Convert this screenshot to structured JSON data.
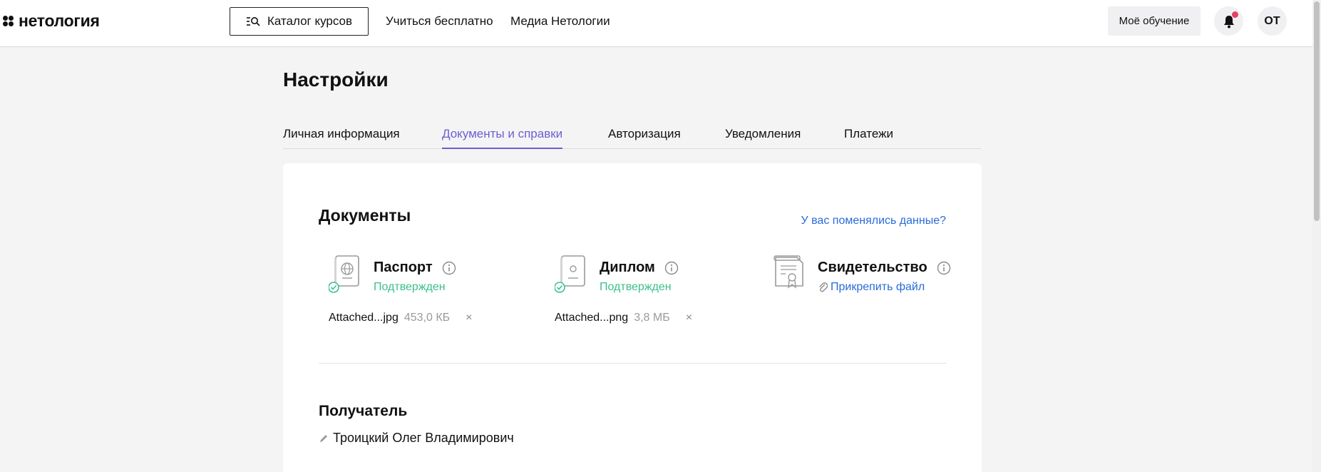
{
  "header": {
    "logo_text": "нетология",
    "catalog_label": "Каталог курсов",
    "nav": {
      "learn_free": "Учиться бесплатно",
      "media": "Медиа Нетологии"
    },
    "my_learning_label": "Моё обучение",
    "avatar_initials": "ОТ",
    "notification_dot_color": "#e63f66"
  },
  "page": {
    "title": "Настройки",
    "tabs": [
      {
        "label": "Личная информация",
        "active": false
      },
      {
        "label": "Документы и справки",
        "active": true
      },
      {
        "label": "Авторизация",
        "active": false
      },
      {
        "label": "Уведомления",
        "active": false
      },
      {
        "label": "Платежи",
        "active": false
      }
    ]
  },
  "documents": {
    "title": "Документы",
    "changed_link": "У вас поменялись данные?",
    "items": [
      {
        "name": "Паспорт",
        "icon": "passport-icon",
        "status": "Подтвержден",
        "file_name": "Attached...jpg",
        "file_size": "453,0 КБ",
        "remove": "×"
      },
      {
        "name": "Диплом",
        "icon": "diploma-icon",
        "status": "Подтвержден",
        "file_name": "Attached...png",
        "file_size": "3,8 МБ",
        "remove": "×"
      },
      {
        "name": "Свидетельство",
        "icon": "certificate-icon",
        "attach_label": "Прикрепить файл"
      }
    ]
  },
  "recipient": {
    "title": "Получатель",
    "name": "Троицкий Олег Владимирович"
  },
  "colors": {
    "accent": "#6b5ed6",
    "link": "#2a6bd8",
    "status_ok": "#3cc08a"
  }
}
